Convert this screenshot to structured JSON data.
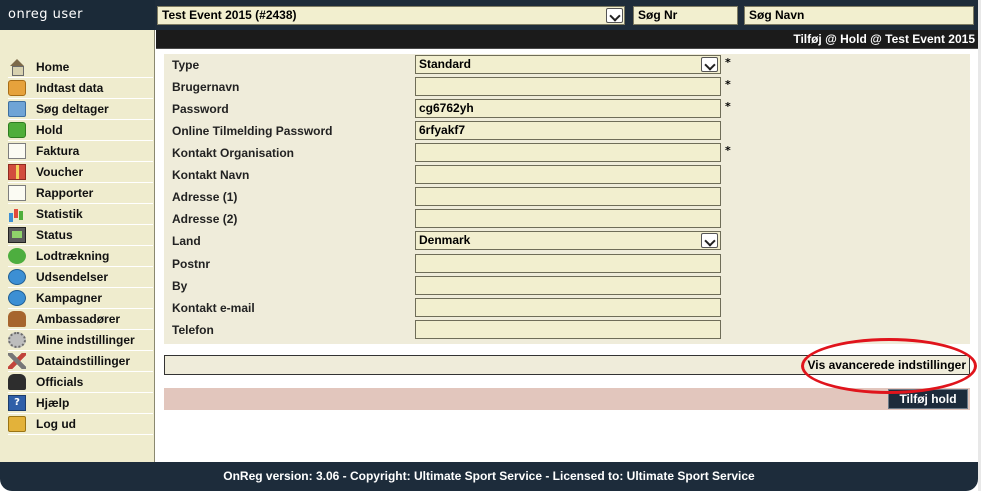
{
  "app": {
    "brand": "onreg user"
  },
  "topbar": {
    "event_select_value": "Test Event 2015 (#2438)",
    "search_nr_placeholder": "Søg Nr",
    "search_name_placeholder": "Søg Navn"
  },
  "sidebar": {
    "items": [
      {
        "label": "Home",
        "icon": "home-icon"
      },
      {
        "label": "Indtast data",
        "icon": "add-user-icon"
      },
      {
        "label": "Søg deltager",
        "icon": "search-icon"
      },
      {
        "label": "Hold",
        "icon": "team-icon"
      },
      {
        "label": "Faktura",
        "icon": "invoice-icon"
      },
      {
        "label": "Voucher",
        "icon": "gift-icon"
      },
      {
        "label": "Rapporter",
        "icon": "report-icon"
      },
      {
        "label": "Statistik",
        "icon": "bar-chart-icon"
      },
      {
        "label": "Status",
        "icon": "status-icon"
      },
      {
        "label": "Lodtrækning",
        "icon": "shuffle-icon"
      },
      {
        "label": "Udsendelser",
        "icon": "mail-globe-icon"
      },
      {
        "label": "Kampagner",
        "icon": "campaign-icon"
      },
      {
        "label": "Ambassadører",
        "icon": "ambassadors-icon"
      },
      {
        "label": "Mine indstillinger",
        "icon": "gear-icon"
      },
      {
        "label": "Dataindstillinger",
        "icon": "tools-icon"
      },
      {
        "label": "Officials",
        "icon": "officials-icon"
      },
      {
        "label": "Hjælp",
        "icon": "help-icon"
      },
      {
        "label": "Log ud",
        "icon": "logout-icon"
      }
    ]
  },
  "header": {
    "title": "Tilføj @ Hold @ Test Event 2015"
  },
  "form": {
    "fields": [
      {
        "label": "Type",
        "value": "Standard",
        "kind": "select",
        "required": true
      },
      {
        "label": "Brugernavn",
        "value": "",
        "kind": "text",
        "required": true
      },
      {
        "label": "Password",
        "value": "cg6762yh",
        "kind": "text",
        "required": true
      },
      {
        "label": "Online Tilmelding Password",
        "value": "6rfyakf7",
        "kind": "text",
        "required": false
      },
      {
        "label": "Kontakt Organisation",
        "value": "",
        "kind": "text",
        "required": true
      },
      {
        "label": "Kontakt Navn",
        "value": "",
        "kind": "text",
        "required": false
      },
      {
        "label": "Adresse (1)",
        "value": "",
        "kind": "text",
        "required": false
      },
      {
        "label": "Adresse (2)",
        "value": "",
        "kind": "text",
        "required": false
      },
      {
        "label": "Land",
        "value": "Denmark",
        "kind": "select",
        "required": false
      },
      {
        "label": "Postnr",
        "value": "",
        "kind": "text",
        "required": false
      },
      {
        "label": "By",
        "value": "",
        "kind": "text",
        "required": false
      },
      {
        "label": "Kontakt e-mail",
        "value": "",
        "kind": "text",
        "required": false
      },
      {
        "label": "Telefon",
        "value": "",
        "kind": "text",
        "required": false
      }
    ],
    "required_marker": "*",
    "advanced_link": "Vis avancerede indstillinger",
    "submit_label": "Tilføj hold"
  },
  "footer": {
    "text": "OnReg version: 3.06 - Copyright: Ultimate Sport Service - Licensed to: Ultimate Sport Service"
  },
  "colors": {
    "navy": "#1d2c3b",
    "cream": "#efecce",
    "field_bg": "#f2efcf",
    "highlight_ring": "#e0141c",
    "submit_bar": "#e2c6bd"
  }
}
